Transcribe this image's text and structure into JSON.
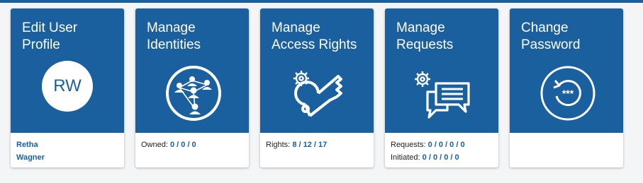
{
  "tiles": {
    "edit_profile": {
      "title_line1": "Edit User",
      "title_line2": "Profile",
      "avatar_initials": "RW",
      "user_first": "Retha",
      "user_last": "Wagner"
    },
    "identities": {
      "title_line1": "Manage",
      "title_line2": "Identities",
      "owned_label": "Owned:",
      "owned_value": "0 / 0 / 0"
    },
    "access_rights": {
      "title_line1": "Manage",
      "title_line2": "Access Rights",
      "rights_label": "Rights:",
      "rights_value": "8 / 12 / 17"
    },
    "requests": {
      "title_line1": "Manage",
      "title_line2": "Requests",
      "requests_label": "Requests:",
      "requests_value": "0 / 0 / 0 / 0",
      "initiated_label": "Initiated:",
      "initiated_value": "0 / 0 / 0 / 0"
    },
    "change_password": {
      "title_line1": "Change",
      "title_line2": "Password",
      "icon_text": "***"
    }
  },
  "colors": {
    "tile_blue": "#1a5f9e",
    "background": "#f4f5f7"
  },
  "icons": {
    "identities": "people-network-icon",
    "access_rights": "key-gear-icon",
    "requests": "chat-gear-icon",
    "change_password": "password-reset-icon"
  }
}
